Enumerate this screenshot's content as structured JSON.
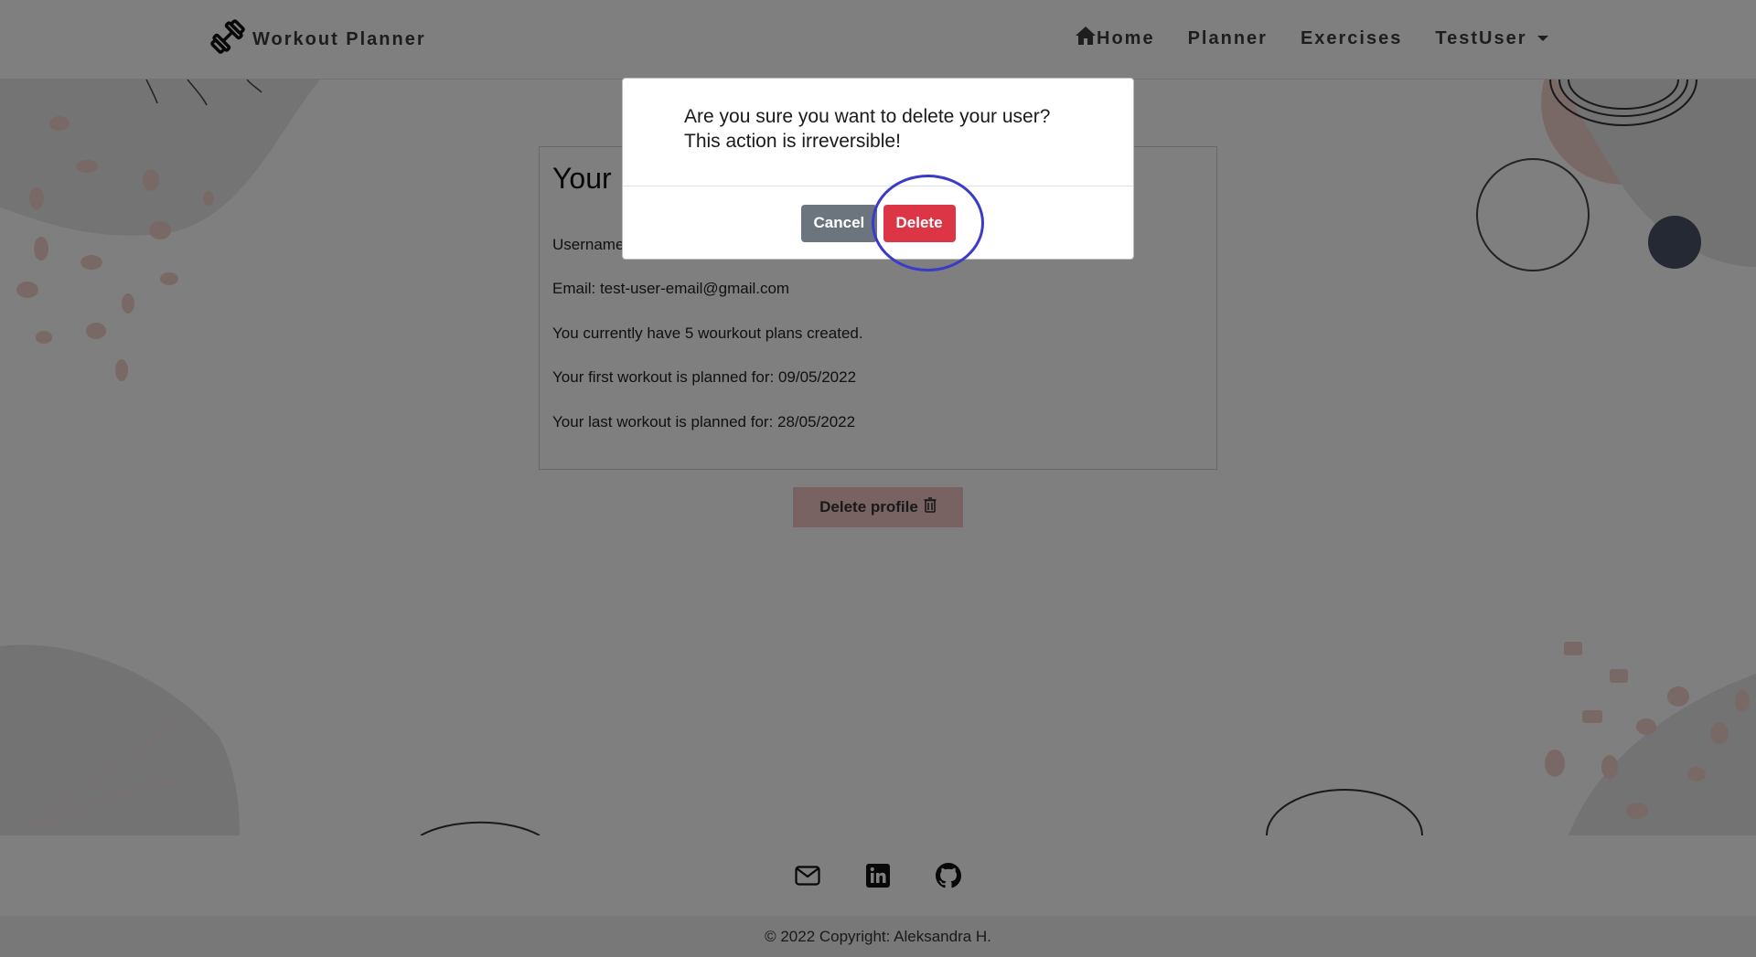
{
  "navbar": {
    "brand": "Workout Planner",
    "links": [
      {
        "label": "Home",
        "icon": "home-icon"
      },
      {
        "label": "Planner"
      },
      {
        "label": "Exercises"
      },
      {
        "label": "TestUser",
        "icon": "caret-down-icon"
      }
    ]
  },
  "profile": {
    "title": "Your",
    "username_label": "Username",
    "email": "Email: test-user-email@gmail.com",
    "plans": "You currently have 5 wourkout plans created.",
    "first_workout": "Your first workout is planned for: 09/05/2022",
    "last_workout": "Your last workout is planned for: 28/05/2022",
    "delete_button": "Delete profile"
  },
  "modal": {
    "message_line1": "Are you sure you want to delete your user?",
    "message_line2": "This action is irreversible!",
    "cancel_label": "Cancel",
    "delete_label": "Delete"
  },
  "footer": {
    "icons": [
      "envelope-icon",
      "linkedin-icon",
      "github-icon"
    ],
    "copyright": "© 2022 Copyright: Aleksandra H."
  },
  "colors": {
    "danger": "#dc3545",
    "secondary": "#6c757d",
    "highlight": "#3b3bc7",
    "overlay": "rgba(0,0,0,0.5)"
  }
}
